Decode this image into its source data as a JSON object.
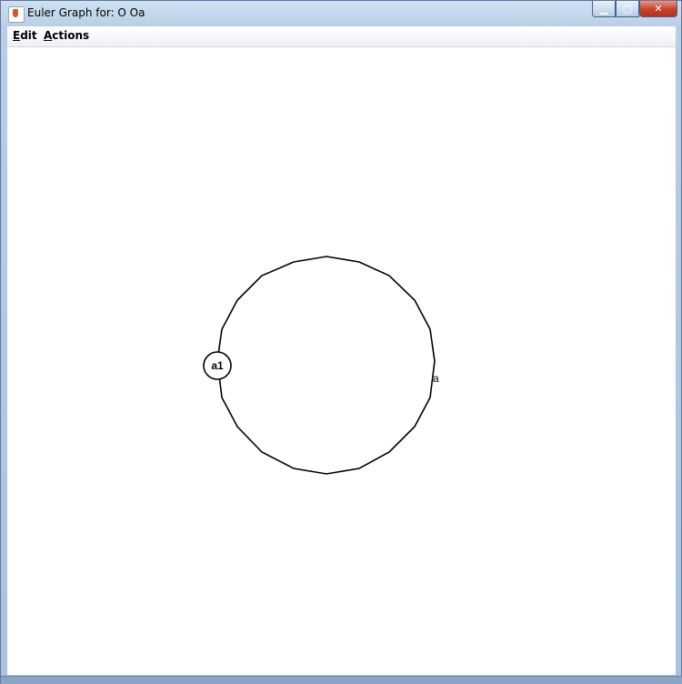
{
  "window": {
    "title": "Euler Graph for: O Oa"
  },
  "menu": [
    {
      "label": "Edit",
      "mnemonic": "E",
      "rest": "dit"
    },
    {
      "label": "Actions",
      "mnemonic": "A",
      "rest": "ctions"
    }
  ],
  "graph": {
    "node_label": "a1",
    "edge_label": "a"
  }
}
